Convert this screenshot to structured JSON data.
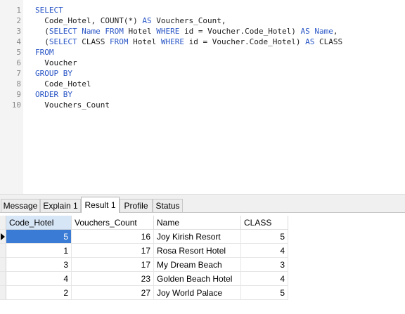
{
  "editor": {
    "line_numbers": [
      "1",
      "2",
      "3",
      "4",
      "5",
      "6",
      "7",
      "8",
      "9",
      "10"
    ],
    "lines": [
      {
        "tokens": [
          {
            "t": "SELECT",
            "kw": true
          }
        ]
      },
      {
        "tokens": [
          {
            "t": "  Code_Hotel, COUNT(*) ",
            "kw": false
          },
          {
            "t": "AS",
            "kw": true
          },
          {
            "t": " Vouchers_Count,",
            "kw": false
          }
        ]
      },
      {
        "tokens": [
          {
            "t": "  (",
            "kw": false
          },
          {
            "t": "SELECT",
            "kw": true
          },
          {
            "t": " ",
            "kw": false
          },
          {
            "t": "Name",
            "kw": true
          },
          {
            "t": " ",
            "kw": false
          },
          {
            "t": "FROM",
            "kw": true
          },
          {
            "t": " Hotel ",
            "kw": false
          },
          {
            "t": "WHERE",
            "kw": true
          },
          {
            "t": " id = Voucher.Code_Hotel) ",
            "kw": false
          },
          {
            "t": "AS",
            "kw": true
          },
          {
            "t": " ",
            "kw": false
          },
          {
            "t": "Name",
            "kw": true
          },
          {
            "t": ",",
            "kw": false
          }
        ]
      },
      {
        "tokens": [
          {
            "t": "  (",
            "kw": false
          },
          {
            "t": "SELECT",
            "kw": true
          },
          {
            "t": " CLASS ",
            "kw": false
          },
          {
            "t": "FROM",
            "kw": true
          },
          {
            "t": " Hotel ",
            "kw": false
          },
          {
            "t": "WHERE",
            "kw": true
          },
          {
            "t": " id = Voucher.Code_Hotel) ",
            "kw": false
          },
          {
            "t": "AS",
            "kw": true
          },
          {
            "t": " CLASS",
            "kw": false
          }
        ]
      },
      {
        "tokens": [
          {
            "t": "FROM",
            "kw": true
          }
        ]
      },
      {
        "tokens": [
          {
            "t": "  Voucher",
            "kw": false
          }
        ]
      },
      {
        "tokens": [
          {
            "t": "GROUP BY",
            "kw": true
          }
        ]
      },
      {
        "tokens": [
          {
            "t": "  Code_Hotel",
            "kw": false
          }
        ]
      },
      {
        "tokens": [
          {
            "t": "ORDER BY",
            "kw": true
          }
        ]
      },
      {
        "tokens": [
          {
            "t": "  Vouchers_Count",
            "kw": false
          }
        ]
      }
    ]
  },
  "tabs": [
    {
      "label": "Message",
      "active": false
    },
    {
      "label": "Explain 1",
      "active": false
    },
    {
      "label": "Result 1",
      "active": true
    },
    {
      "label": "Profile",
      "active": false
    },
    {
      "label": "Status",
      "active": false
    }
  ],
  "grid": {
    "columns": [
      "Code_Hotel",
      "Vouchers_Count",
      "Name",
      "CLASS"
    ],
    "rows": [
      [
        "5",
        "16",
        "Joy Kirish Resort",
        "5"
      ],
      [
        "1",
        "17",
        "Rosa Resort Hotel",
        "4"
      ],
      [
        "3",
        "17",
        "My Dream Beach",
        "3"
      ],
      [
        "4",
        "23",
        "Golden Beach Hotel",
        "4"
      ],
      [
        "2",
        "27",
        "Joy World Palace",
        "5"
      ]
    ],
    "selected_row": 0,
    "colors": {
      "selection": "#3a7bd5",
      "header_selected": "#d7e6f7",
      "keyword": "#2a56c6"
    }
  }
}
